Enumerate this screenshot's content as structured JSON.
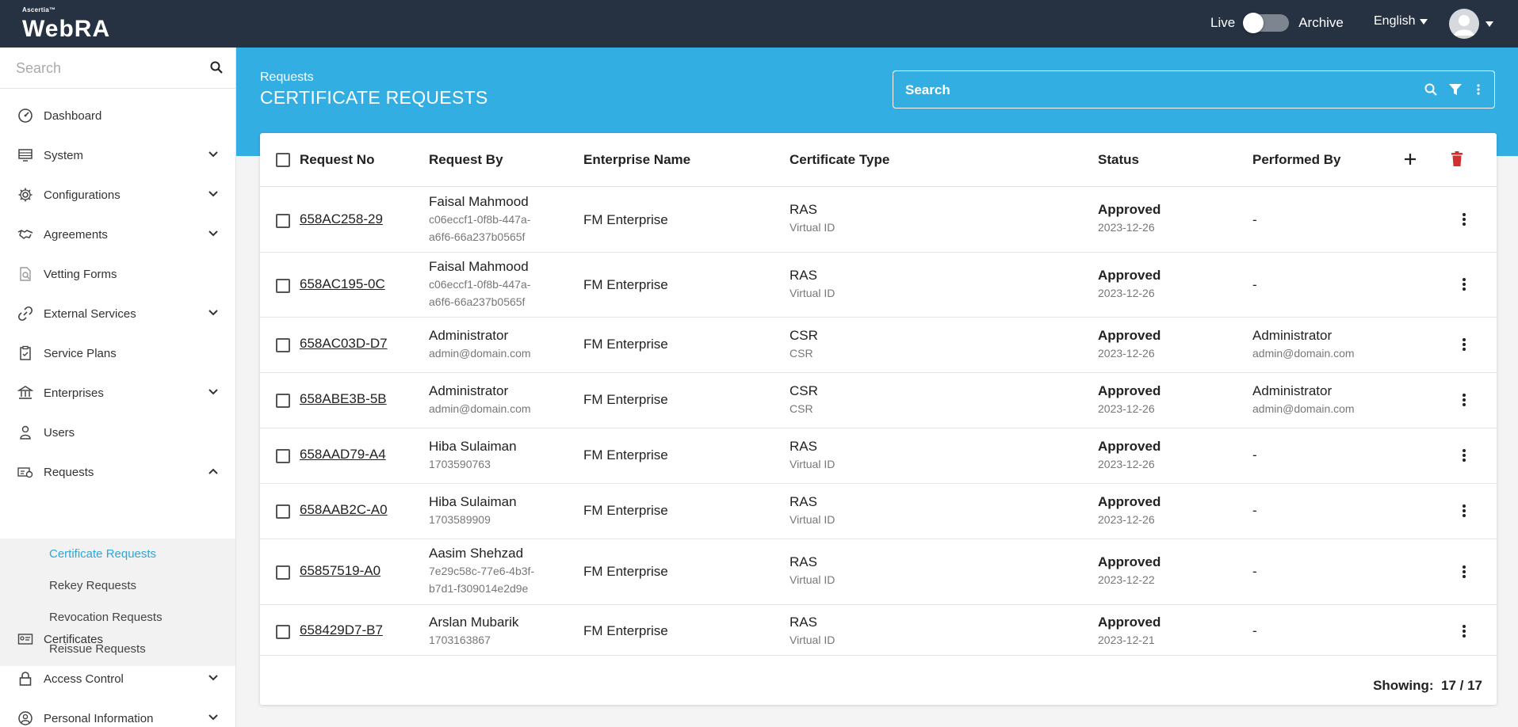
{
  "topbar": {
    "brand_small": "Ascertia™",
    "brand_name": "WebRA",
    "live_label": "Live",
    "archive_label": "Archive",
    "language": "English"
  },
  "sidebar": {
    "search_placeholder": "Search",
    "items": [
      {
        "label": "Dashboard",
        "icon": "dashboard-icon",
        "chevron": "none"
      },
      {
        "label": "System",
        "icon": "system-icon",
        "chevron": "down"
      },
      {
        "label": "Configurations",
        "icon": "gear-icon",
        "chevron": "down"
      },
      {
        "label": "Agreements",
        "icon": "handshake-icon",
        "chevron": "down"
      },
      {
        "label": "Vetting Forms",
        "icon": "document-search-icon",
        "chevron": "none"
      },
      {
        "label": "External Services",
        "icon": "link-icon",
        "chevron": "down"
      },
      {
        "label": "Service Plans",
        "icon": "clipboard-icon",
        "chevron": "none"
      },
      {
        "label": "Enterprises",
        "icon": "bank-icon",
        "chevron": "down"
      },
      {
        "label": "Users",
        "icon": "user-icon",
        "chevron": "none"
      },
      {
        "label": "Requests",
        "icon": "requests-icon",
        "chevron": "up"
      }
    ],
    "sub_items": [
      {
        "label": "Certificate Requests",
        "active": true
      },
      {
        "label": "Rekey Requests",
        "active": false
      },
      {
        "label": "Revocation Requests",
        "active": false
      },
      {
        "label": "Reissue Requests",
        "active": false
      }
    ],
    "bottom_items": [
      {
        "label": "Certificates",
        "icon": "certificate-icon",
        "chevron": "none"
      },
      {
        "label": "Access Control",
        "icon": "lock-icon",
        "chevron": "down"
      },
      {
        "label": "Personal Information",
        "icon": "person-circle-icon",
        "chevron": "down"
      }
    ]
  },
  "header": {
    "breadcrumb": "Requests",
    "title": "CERTIFICATE REQUESTS",
    "search_placeholder": "Search"
  },
  "table": {
    "columns": [
      "Request No",
      "Request By",
      "Enterprise Name",
      "Certificate Type",
      "Status",
      "Performed By"
    ],
    "rows": [
      {
        "request_no": "658AC258-29",
        "by_name": "Faisal Mahmood",
        "by_sub1": "c06eccf1-0f8b-447a-",
        "by_sub2": "a6f6-66a237b0565f",
        "enterprise": "FM Enterprise",
        "type": "RAS",
        "type_sub": "Virtual ID",
        "status": "Approved",
        "date": "2023-12-26",
        "perf_name": "-",
        "perf_sub": ""
      },
      {
        "request_no": "658AC195-0C",
        "by_name": "Faisal Mahmood",
        "by_sub1": "c06eccf1-0f8b-447a-",
        "by_sub2": "a6f6-66a237b0565f",
        "enterprise": "FM Enterprise",
        "type": "RAS",
        "type_sub": "Virtual ID",
        "status": "Approved",
        "date": "2023-12-26",
        "perf_name": "-",
        "perf_sub": ""
      },
      {
        "request_no": "658AC03D-D7",
        "by_name": "Administrator",
        "by_sub1": "admin@domain.com",
        "by_sub2": "",
        "enterprise": "FM Enterprise",
        "type": "CSR",
        "type_sub": "CSR",
        "status": "Approved",
        "date": "2023-12-26",
        "perf_name": "Administrator",
        "perf_sub": "admin@domain.com"
      },
      {
        "request_no": "658ABE3B-5B",
        "by_name": "Administrator",
        "by_sub1": "admin@domain.com",
        "by_sub2": "",
        "enterprise": "FM Enterprise",
        "type": "CSR",
        "type_sub": "CSR",
        "status": "Approved",
        "date": "2023-12-26",
        "perf_name": "Administrator",
        "perf_sub": "admin@domain.com"
      },
      {
        "request_no": "658AAD79-A4",
        "by_name": "Hiba Sulaiman",
        "by_sub1": "1703590763",
        "by_sub2": "",
        "enterprise": "FM Enterprise",
        "type": "RAS",
        "type_sub": "Virtual ID",
        "status": "Approved",
        "date": "2023-12-26",
        "perf_name": "-",
        "perf_sub": ""
      },
      {
        "request_no": "658AAB2C-A0",
        "by_name": "Hiba Sulaiman",
        "by_sub1": "1703589909",
        "by_sub2": "",
        "enterprise": "FM Enterprise",
        "type": "RAS",
        "type_sub": "Virtual ID",
        "status": "Approved",
        "date": "2023-12-26",
        "perf_name": "-",
        "perf_sub": ""
      },
      {
        "request_no": "65857519-A0",
        "by_name": "Aasim Shehzad",
        "by_sub1": "7e29c58c-77e6-4b3f-",
        "by_sub2": "b7d1-f309014e2d9e",
        "enterprise": "FM Enterprise",
        "type": "RAS",
        "type_sub": "Virtual ID",
        "status": "Approved",
        "date": "2023-12-22",
        "perf_name": "-",
        "perf_sub": ""
      },
      {
        "request_no": "658429D7-B7",
        "by_name": "Arslan Mubarik",
        "by_sub1": "1703163867",
        "by_sub2": "",
        "enterprise": "FM Enterprise",
        "type": "RAS",
        "type_sub": "Virtual ID",
        "status": "Approved",
        "date": "2023-12-21",
        "perf_name": "-",
        "perf_sub": ""
      }
    ],
    "showing_label": "Showing:",
    "showing_value": "17 / 17"
  },
  "colors": {
    "topbar": "#263142",
    "accent": "#33aee3",
    "active_link": "#29a8dc",
    "delete": "#d32f2f"
  }
}
